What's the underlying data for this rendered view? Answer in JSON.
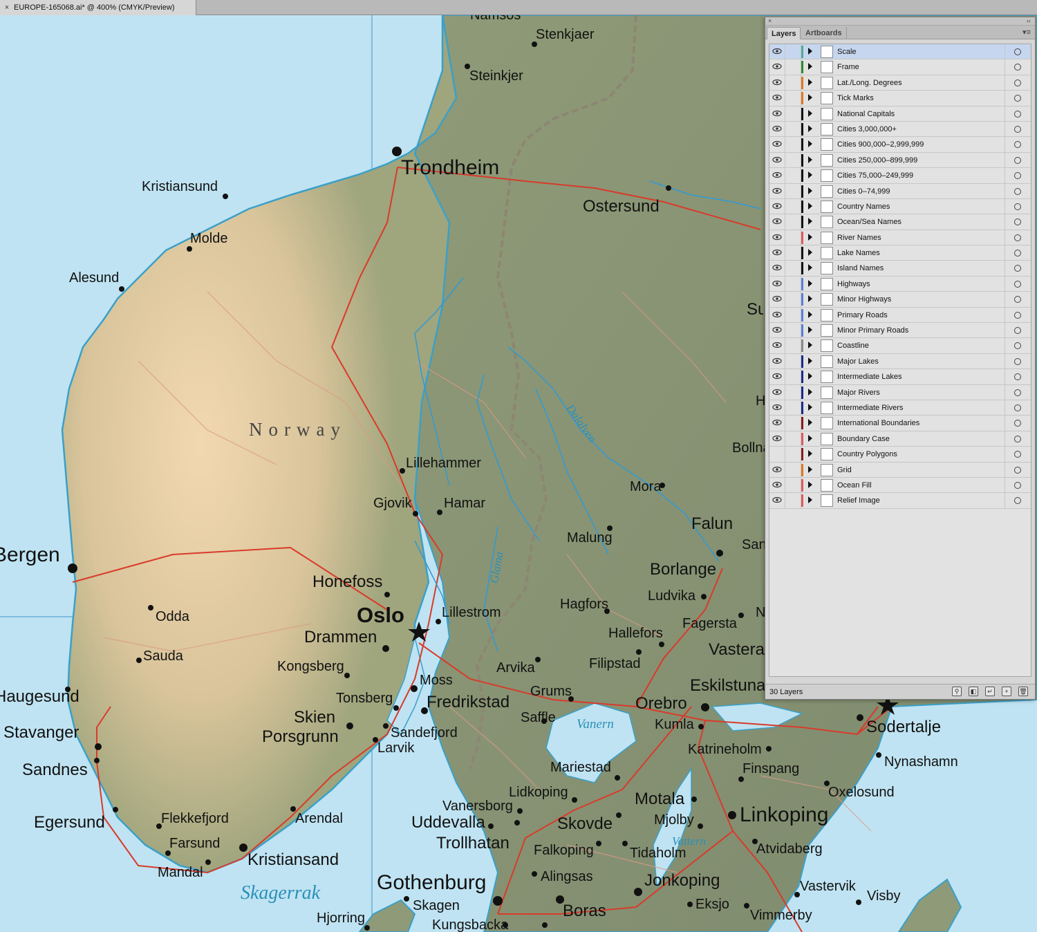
{
  "document_tab": {
    "close_glyph": "×",
    "title": "EUROPE-165068.ai* @ 400% (CMYK/Preview)"
  },
  "map": {
    "country_label": "Norway",
    "sea_label": "Skagerrak",
    "lake_labels": [
      "Vanern",
      "Vattern"
    ],
    "river_labels": [
      "Dalalven",
      "Glama"
    ],
    "cities": [
      {
        "name": "Namsos",
        "size": 1
      },
      {
        "name": "Stenkjaer",
        "size": 1
      },
      {
        "name": "Steinkjer",
        "size": 1
      },
      {
        "name": "Trondheim",
        "size": 3
      },
      {
        "name": "Kristiansund",
        "size": 1
      },
      {
        "name": "Ostersund",
        "size": 2
      },
      {
        "name": "Molde",
        "size": 1
      },
      {
        "name": "Alesund",
        "size": 1
      },
      {
        "name": "Sundsvall",
        "size": 2
      },
      {
        "name": "Hudiksvall",
        "size": 1
      },
      {
        "name": "Bollnas",
        "size": 1
      },
      {
        "name": "Lillehammer",
        "size": 1
      },
      {
        "name": "Gjovik",
        "size": 1
      },
      {
        "name": "Hamar",
        "size": 1
      },
      {
        "name": "Mora",
        "size": 1
      },
      {
        "name": "Malung",
        "size": 1
      },
      {
        "name": "Falun",
        "size": 2
      },
      {
        "name": "Sandviken",
        "size": 1
      },
      {
        "name": "Bergen",
        "size": 3
      },
      {
        "name": "Honefoss",
        "size": 2
      },
      {
        "name": "Borlange",
        "size": 2
      },
      {
        "name": "Ludvika",
        "size": 1
      },
      {
        "name": "Odda",
        "size": 1
      },
      {
        "name": "Oslo",
        "size": 4
      },
      {
        "name": "Lillestrom",
        "size": 1
      },
      {
        "name": "Hagfors",
        "size": 1
      },
      {
        "name": "Fagersta",
        "size": 1
      },
      {
        "name": "Norberg",
        "size": 1
      },
      {
        "name": "Hallefors",
        "size": 1
      },
      {
        "name": "Drammen",
        "size": 2
      },
      {
        "name": "Sauda",
        "size": 1
      },
      {
        "name": "Vasteras",
        "size": 2
      },
      {
        "name": "Kongsberg",
        "size": 1
      },
      {
        "name": "Arvika",
        "size": 1
      },
      {
        "name": "Filipstad",
        "size": 1
      },
      {
        "name": "Moss",
        "size": 1
      },
      {
        "name": "Haugesund",
        "size": 2
      },
      {
        "name": "Eskilstuna",
        "size": 2
      },
      {
        "name": "Tonsberg",
        "size": 1
      },
      {
        "name": "Grums",
        "size": 1
      },
      {
        "name": "Fredrikstad",
        "size": 2
      },
      {
        "name": "Orebro",
        "size": 2
      },
      {
        "name": "Skien",
        "size": 2
      },
      {
        "name": "Saffle",
        "size": 1
      },
      {
        "name": "Sandefjord",
        "size": 1
      },
      {
        "name": "Kumla",
        "size": 1
      },
      {
        "name": "Porsgrunn",
        "size": 2
      },
      {
        "name": "Stavanger",
        "size": 2
      },
      {
        "name": "Sodertalje",
        "size": 2
      },
      {
        "name": "Larvik",
        "size": 1
      },
      {
        "name": "Katrineholm",
        "size": 1
      },
      {
        "name": "Nynashamn",
        "size": 1
      },
      {
        "name": "Sandnes",
        "size": 2
      },
      {
        "name": "Mariestad",
        "size": 1
      },
      {
        "name": "Finspang",
        "size": 1
      },
      {
        "name": "Oxelosund",
        "size": 1
      },
      {
        "name": "Lidkoping",
        "size": 1
      },
      {
        "name": "Motala",
        "size": 2
      },
      {
        "name": "Vanersborg",
        "size": 1
      },
      {
        "name": "Flekkefjord",
        "size": 1
      },
      {
        "name": "Arendal",
        "size": 1
      },
      {
        "name": "Mjolby",
        "size": 1
      },
      {
        "name": "Linkoping",
        "size": 2
      },
      {
        "name": "Egersund",
        "size": 2
      },
      {
        "name": "Uddevalla",
        "size": 2
      },
      {
        "name": "Skovde",
        "size": 2
      },
      {
        "name": "Trollhatan",
        "size": 2
      },
      {
        "name": "Atvidaberg",
        "size": 1
      },
      {
        "name": "Farsund",
        "size": 1
      },
      {
        "name": "Falkoping",
        "size": 1
      },
      {
        "name": "Tidaholm",
        "size": 1
      },
      {
        "name": "Kristiansand",
        "size": 2
      },
      {
        "name": "Mandal",
        "size": 1
      },
      {
        "name": "Alingsas",
        "size": 1
      },
      {
        "name": "Jonkoping",
        "size": 2
      },
      {
        "name": "Vastervik",
        "size": 1
      },
      {
        "name": "Gothenburg",
        "size": 3
      },
      {
        "name": "Visby",
        "size": 1
      },
      {
        "name": "Skagen",
        "size": 1
      },
      {
        "name": "Eksjo",
        "size": 1
      },
      {
        "name": "Boras",
        "size": 2
      },
      {
        "name": "Hjorring",
        "size": 1
      },
      {
        "name": "Vimmerby",
        "size": 1
      },
      {
        "name": "Kungsbacka",
        "size": 1
      }
    ]
  },
  "layers_panel": {
    "close_glyph": "×",
    "collapse_glyph": "‹‹",
    "menu_glyph": "▾≡",
    "tabs": [
      {
        "label": "Layers",
        "active": true
      },
      {
        "label": "Artboards",
        "active": false
      }
    ],
    "layers": [
      {
        "name": "Scale",
        "color": "#4fa7a0",
        "visible": true,
        "selected": true
      },
      {
        "name": "Frame",
        "color": "#2f8a2f",
        "visible": true
      },
      {
        "name": "Lat./Long. Degrees",
        "color": "#e0781e",
        "visible": true
      },
      {
        "name": "Tick Marks",
        "color": "#e0781e",
        "visible": true
      },
      {
        "name": "National Capitals",
        "color": "#111111",
        "visible": true
      },
      {
        "name": "Cities 3,000,000+",
        "color": "#111111",
        "visible": true
      },
      {
        "name": "Cities 900,000–2,999,999",
        "color": "#111111",
        "visible": true
      },
      {
        "name": "Cities 250,000–899,999",
        "color": "#111111",
        "visible": true
      },
      {
        "name": "Cities 75,000–249,999",
        "color": "#111111",
        "visible": true
      },
      {
        "name": "Cities 0–74,999",
        "color": "#111111",
        "visible": true
      },
      {
        "name": "Country Names",
        "color": "#111111",
        "visible": true
      },
      {
        "name": "Ocean/Sea Names",
        "color": "#111111",
        "visible": true
      },
      {
        "name": "River Names",
        "color": "#e05a5a",
        "visible": true
      },
      {
        "name": "Lake Names",
        "color": "#111111",
        "visible": true
      },
      {
        "name": "Island Names",
        "color": "#111111",
        "visible": true
      },
      {
        "name": "Highways",
        "color": "#5a7fd8",
        "visible": true
      },
      {
        "name": "Minor Highways",
        "color": "#5a7fd8",
        "visible": true
      },
      {
        "name": "Primary Roads",
        "color": "#5a7fd8",
        "visible": true
      },
      {
        "name": "Minor Primary Roads",
        "color": "#5a7fd8",
        "visible": true
      },
      {
        "name": "Coastline",
        "color": "#888888",
        "visible": true
      },
      {
        "name": "Major Lakes",
        "color": "#1a2a8a",
        "visible": true
      },
      {
        "name": "Intermediate Lakes",
        "color": "#1a2a8a",
        "visible": true
      },
      {
        "name": "Major Rivers",
        "color": "#1a2a8a",
        "visible": true
      },
      {
        "name": "Intermediate Rivers",
        "color": "#1a2a8a",
        "visible": true
      },
      {
        "name": "International Boundaries",
        "color": "#8a1a1a",
        "visible": true
      },
      {
        "name": "Boundary Case",
        "color": "#e05a5a",
        "visible": true
      },
      {
        "name": "Country Polygons",
        "color": "#8a1a1a",
        "visible": false
      },
      {
        "name": "Grid",
        "color": "#e0781e",
        "visible": true
      },
      {
        "name": "Ocean Fill",
        "color": "#e05a5a",
        "visible": true
      },
      {
        "name": "Relief Image",
        "color": "#e05a5a",
        "visible": true
      }
    ],
    "layer_count_label": "30 Layers",
    "bottom_icons": [
      "search-icon",
      "make-clipping-mask-icon",
      "create-sublayer-icon",
      "new-layer-icon",
      "trash-icon"
    ]
  }
}
